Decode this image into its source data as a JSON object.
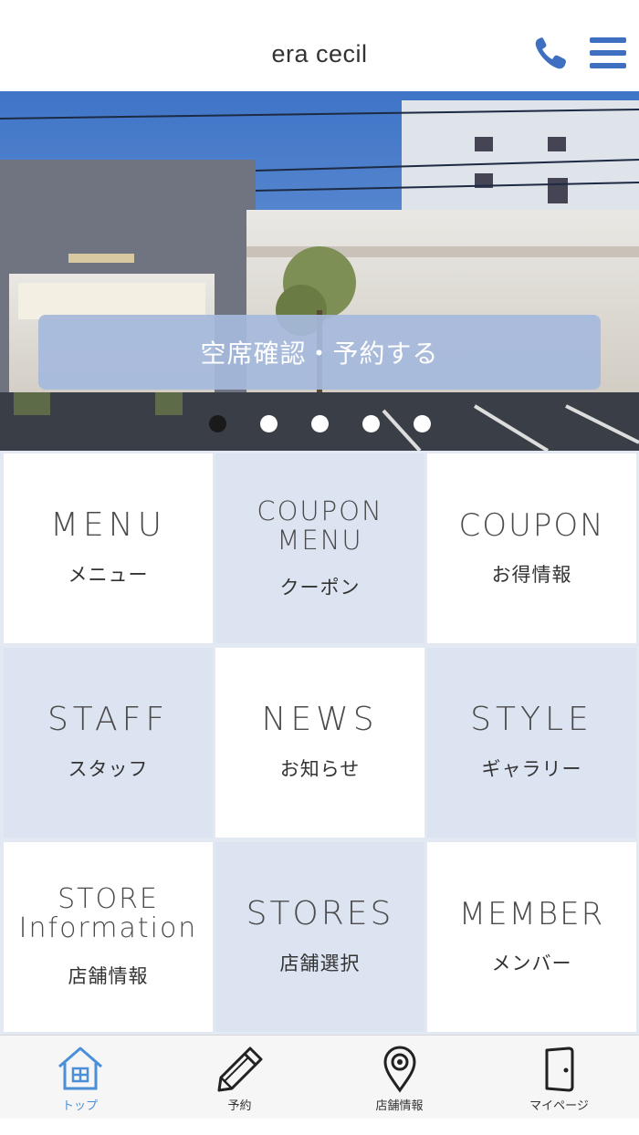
{
  "header": {
    "title": "era cecil",
    "phone_icon": "phone-icon",
    "menu_icon": "hamburger-menu-icon"
  },
  "hero": {
    "image": "salon-storefront-photo",
    "reserve_label": "空席確認・予約する",
    "carousel": {
      "count": 5,
      "active_index": 0
    }
  },
  "menu_grid": [
    {
      "en": "MENU",
      "jp": "メニュー"
    },
    {
      "en": "COUPON MENU",
      "jp": "クーポン"
    },
    {
      "en": "COUPON",
      "jp": "お得情報"
    },
    {
      "en": "STAFF",
      "jp": "スタッフ"
    },
    {
      "en": "NEWS",
      "jp": "お知らせ"
    },
    {
      "en": "STYLE",
      "jp": "ギャラリー"
    },
    {
      "en": "STORE Information",
      "jp": "店舗情報"
    },
    {
      "en": "STORES",
      "jp": "店舗選択"
    },
    {
      "en": "MEMBER",
      "jp": "メンバー"
    }
  ],
  "tabbar": [
    {
      "label": "トップ",
      "icon": "home-icon",
      "active": true
    },
    {
      "label": "予約",
      "icon": "pencil-icon",
      "active": false
    },
    {
      "label": "店舗情報",
      "icon": "map-pin-icon",
      "active": false
    },
    {
      "label": "マイページ",
      "icon": "door-icon",
      "active": false
    }
  ],
  "colors": {
    "accent": "#3f6fc0",
    "active_tab": "#4a8fd8",
    "tile_blue": "#dce4f2",
    "reserve_button": "#a6b9dc"
  }
}
